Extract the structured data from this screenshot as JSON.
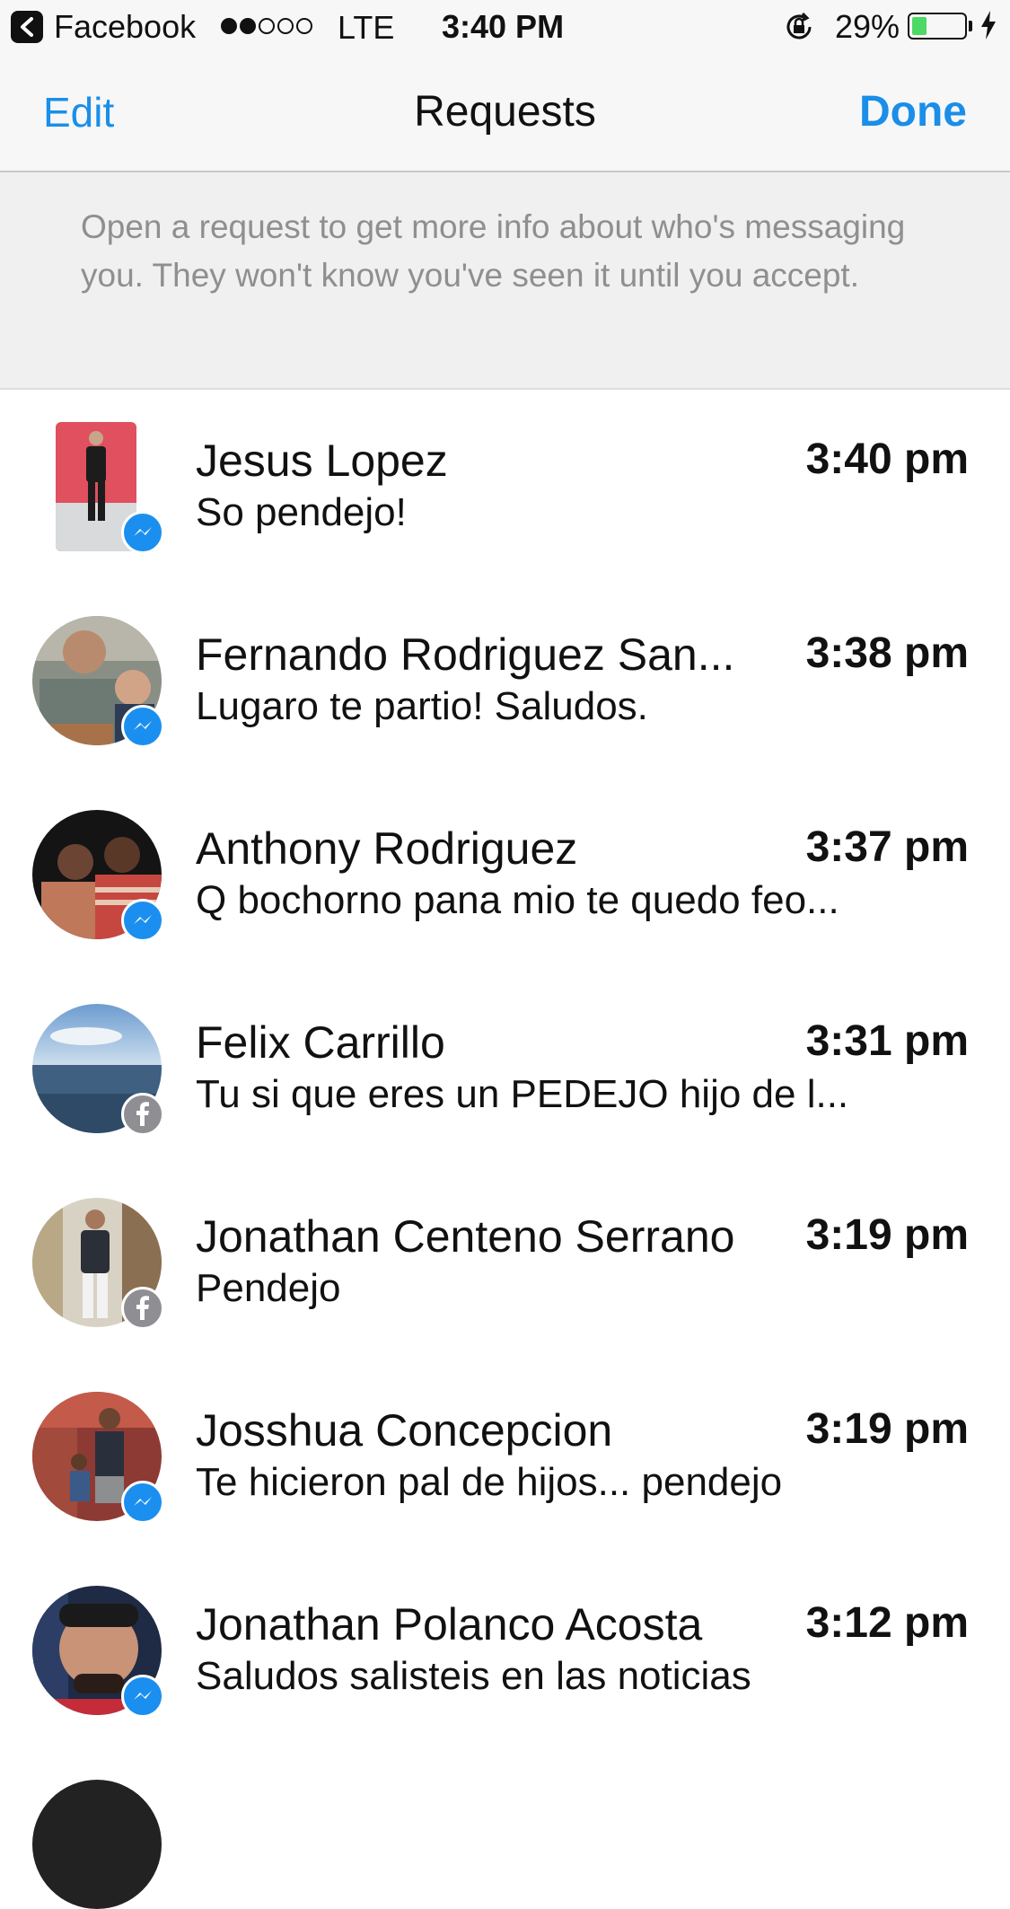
{
  "status_bar": {
    "back_app": "Facebook",
    "carrier": "LTE",
    "time": "3:40 PM",
    "battery_percent": "29%",
    "battery_level": 0.29,
    "signal_bars_filled": 2,
    "signal_bars_total": 5
  },
  "nav": {
    "edit_label": "Edit",
    "title": "Requests",
    "done_label": "Done"
  },
  "info_banner": {
    "text": "Open a request to get more info about who's messaging you. They won't know you've seen it until you accept."
  },
  "colors": {
    "accent": "#1a8ee8",
    "messenger_badge": "#1b8ff0",
    "facebook_badge": "#8e8e93",
    "battery_fill": "#4cd964"
  },
  "requests": [
    {
      "name": "Jesus Lopez",
      "time": "3:40 pm",
      "preview": "So pendejo!",
      "badge": "messenger-icon"
    },
    {
      "name": "Fernando Rodriguez San...",
      "time": "3:38 pm",
      "preview": "Lugaro te partio! Saludos.",
      "badge": "messenger-icon"
    },
    {
      "name": "Anthony Rodriguez",
      "time": "3:37 pm",
      "preview": "Q bochorno pana mio te quedo feo...",
      "badge": "messenger-icon"
    },
    {
      "name": "Felix Carrillo",
      "time": "3:31 pm",
      "preview": "Tu si que eres un PEDEJO hijo de l...",
      "badge": "facebook-icon"
    },
    {
      "name": "Jonathan Centeno Serrano",
      "time": "3:19 pm",
      "preview": "Pendejo",
      "badge": "facebook-icon"
    },
    {
      "name": "Josshua Concepcion",
      "time": "3:19 pm",
      "preview": "Te hicieron pal de hijos... pendejo",
      "badge": "messenger-icon"
    },
    {
      "name": "Jonathan Polanco Acosta",
      "time": "3:12 pm",
      "preview": "Saludos salisteis en las noticias",
      "badge": "messenger-icon"
    }
  ]
}
